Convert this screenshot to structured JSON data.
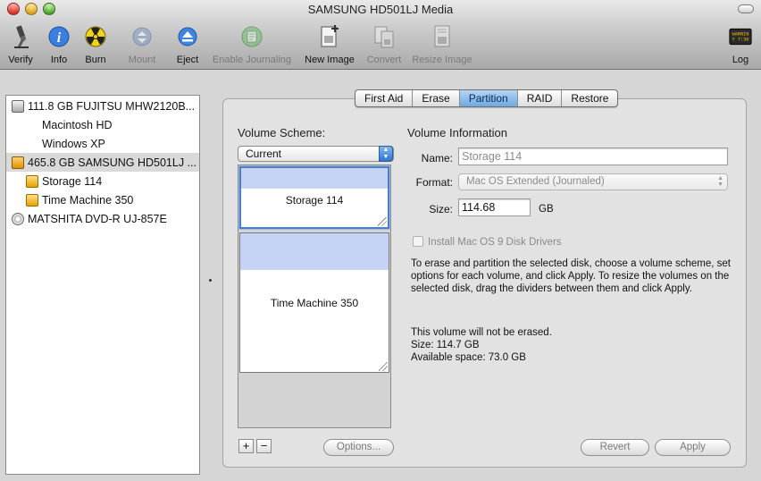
{
  "window": {
    "title": "SAMSUNG HD501LJ Media"
  },
  "toolbar": {
    "verify": "Verify",
    "info": "Info",
    "burn": "Burn",
    "mount": "Mount",
    "eject": "Eject",
    "enable_journaling": "Enable Journaling",
    "new_image": "New Image",
    "convert": "Convert",
    "resize_image": "Resize Image",
    "log": "Log",
    "log_icon_text_1": "WARNIN",
    "log_icon_text_2": "Y 7:36"
  },
  "sidebar": {
    "items": [
      {
        "label": "111.8 GB FUJITSU MHW2120B...",
        "kind": "disk"
      },
      {
        "label": "Macintosh HD",
        "kind": "volume"
      },
      {
        "label": "Windows XP",
        "kind": "volume"
      },
      {
        "label": "465.8 GB SAMSUNG HD501LJ ...",
        "kind": "disk",
        "selected": true
      },
      {
        "label": "Storage 114",
        "kind": "volume"
      },
      {
        "label": "Time Machine 350",
        "kind": "volume"
      },
      {
        "label": "MATSHITA DVD-R UJ-857E",
        "kind": "optical"
      }
    ]
  },
  "tabs": [
    "First Aid",
    "Erase",
    "Partition",
    "RAID",
    "Restore"
  ],
  "active_tab": "Partition",
  "partition": {
    "scheme_label": "Volume Scheme:",
    "scheme_value": "Current",
    "partitions": [
      "Storage 114",
      "Time Machine 350"
    ],
    "add_symbol": "+",
    "remove_symbol": "−",
    "options_button": "Options..."
  },
  "volume_info": {
    "heading": "Volume Information",
    "name_label": "Name:",
    "name_value": "Storage 114",
    "format_label": "Format:",
    "format_value": "Mac OS Extended (Journaled)",
    "size_label": "Size:",
    "size_value": "114.68",
    "size_unit": "GB",
    "os9_checkbox": "Install Mac OS 9 Disk Drivers",
    "instructions": "To erase and partition the selected disk, choose a volume scheme, set options for each volume, and click Apply. To resize the volumes on the selected disk, drag the dividers between them and click Apply.",
    "status_line": "This volume will not be erased.",
    "size_line": "Size: 114.7 GB",
    "available_line": "Available space: 73.0 GB"
  },
  "buttons": {
    "revert": "Revert",
    "apply": "Apply"
  },
  "colors": {
    "accent": "#6ea8e4",
    "partition_band": "#c7d3f4",
    "selection": "#d9d9d9"
  }
}
